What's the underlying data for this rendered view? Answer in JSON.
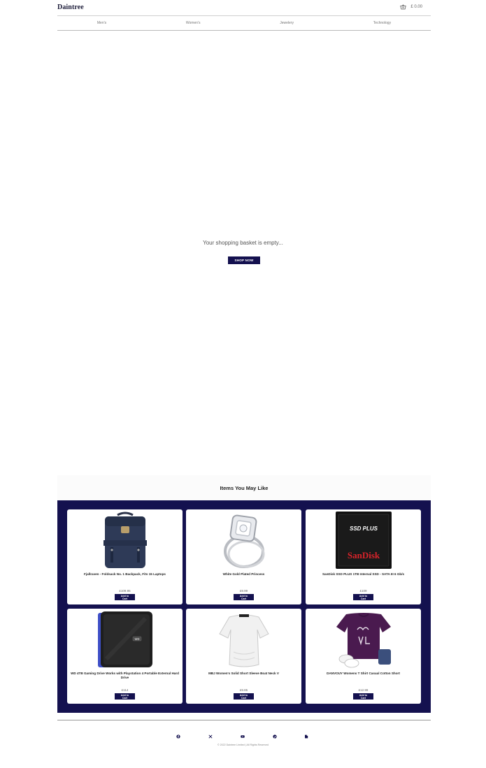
{
  "brand": {
    "logo": "Daintree"
  },
  "cart": {
    "total": "£ 0.00"
  },
  "nav": [
    {
      "label": "Men's"
    },
    {
      "label": "Women's"
    },
    {
      "label": "Jewelery"
    },
    {
      "label": "Technology"
    }
  ],
  "basket": {
    "message": "Your shopping basket is empty...",
    "cta": "SHOP NOW"
  },
  "suggestions": {
    "title": "Items You May Like",
    "add_label": "Add to Cart",
    "products": [
      {
        "name": "Fjallraven - Foldsack No. 1 Backpack, Fits 15 Laptops",
        "price": "£109.95",
        "image": "backpack"
      },
      {
        "name": "White Gold Plated Princess",
        "price": "£9.99",
        "image": "ring"
      },
      {
        "name": "SanDisk SSD PLUS 1TB Internal SSD - SATA III 6 Gb/s",
        "price": "£109",
        "image": "ssd"
      },
      {
        "name": "WD 4TB Gaming Drive Works with Playstation 4 Portable External Hard Drive",
        "price": "£114",
        "image": "hard-drive"
      },
      {
        "name": "MBJ Women's Solid Short Sleeve Boat Neck V",
        "price": "£9.85",
        "image": "white-top"
      },
      {
        "name": "DANVOUY Womens T Shirt Casual Cotton Short",
        "price": "£12.99",
        "image": "purple-tshirt"
      }
    ]
  },
  "footer": {
    "socials": [
      "facebook-icon",
      "x-icon",
      "youtube-icon",
      "pinterest-icon",
      "tiktok-icon"
    ],
    "copyright": "© 2022 Daintree Limited | All Rights Reserved"
  },
  "colors": {
    "brand_navy": "#14114f",
    "background": "#ffffff"
  },
  "ssd_brand": {
    "line1": "SSD PLUS",
    "line2": "SanDisk"
  },
  "drive_badge": "WD"
}
